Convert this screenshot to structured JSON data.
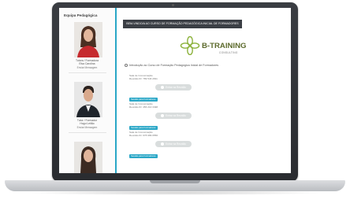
{
  "sidebar": {
    "title": "Equipa Pedagógica",
    "people": [
      {
        "role": "Tutora / Formadora",
        "name": "Elsa Carolina",
        "link": "Enviar Mensagem"
      },
      {
        "role": "Tutor / Formador",
        "name": "Hugo Leitão",
        "link": "Enviar Mensagem"
      },
      {
        "role": "",
        "name": "",
        "link": ""
      }
    ]
  },
  "header": {
    "title": "BEM-VINDO/A AO CURSO DE FORMAÇÃO PEDAGÓGICA INICIAL DE FORMADORES"
  },
  "brand": {
    "name": "B-TRAINING",
    "subtitle": "CONSULTING",
    "logo_color": "#8bb13a"
  },
  "course": {
    "intro": "Introdução ao Curso de Formação Pedagógica Inicial de Formadores"
  },
  "sessions": [
    {
      "tag": "",
      "label": "Sala de Conversação",
      "id": "Reunião ID: 789 543 2811",
      "button": "Entrar na Reunião"
    },
    {
      "tag": "Sessão para Formadores",
      "label": "Sala de Conversação",
      "id": "Reunião ID: 456 210 3498",
      "button": "Entrar na Reunião"
    },
    {
      "tag": "Sessão para Formadores",
      "label": "Sala de Conversação",
      "id": "Reunião ID: 678 989 0556",
      "button": "Entrar na Reunião"
    },
    {
      "tag": "Sessão para Formadores",
      "label": "",
      "id": "",
      "button": ""
    }
  ],
  "colors": {
    "accent": "#2aa7c7",
    "header_bg": "#3b3f45",
    "button_bg": "#d9dddd"
  }
}
